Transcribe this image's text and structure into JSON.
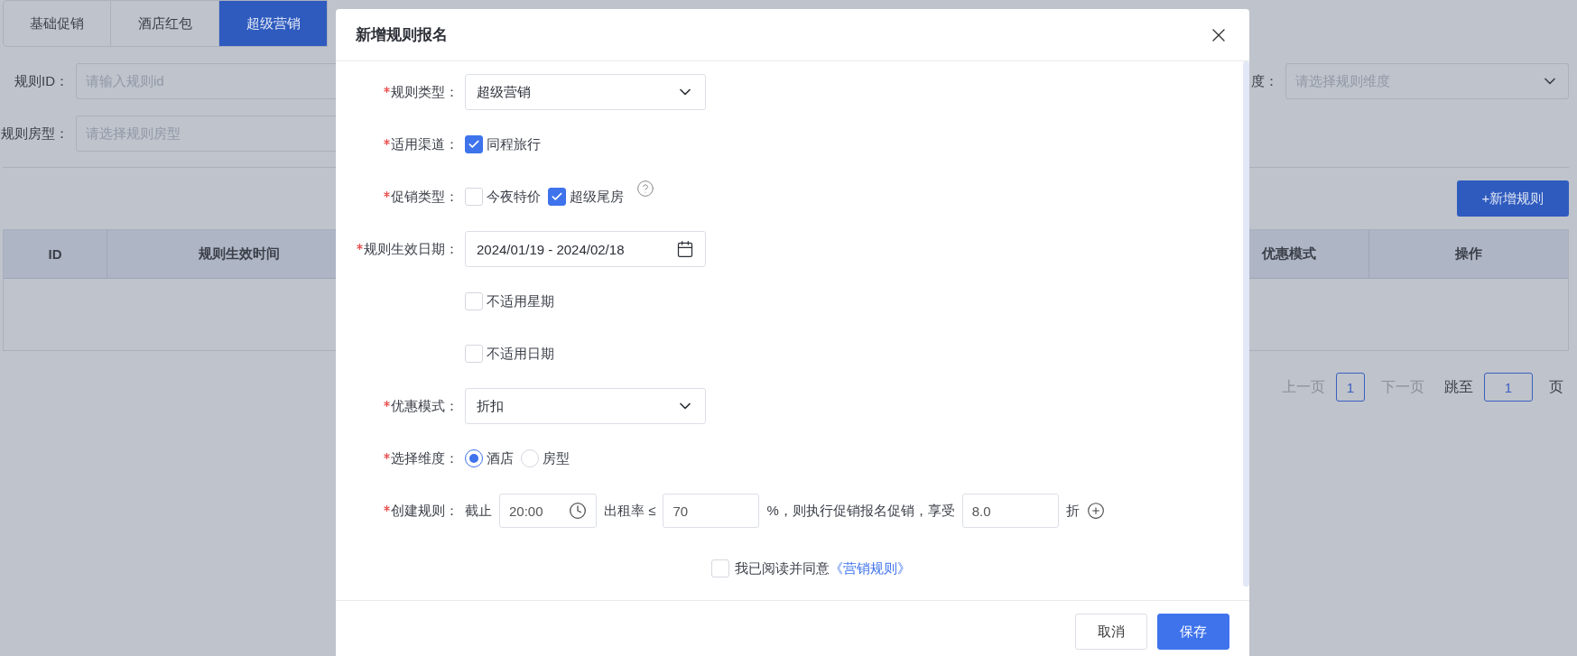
{
  "tabs": [
    {
      "label": "基础促销",
      "selected": false
    },
    {
      "label": "酒店红包",
      "selected": false
    },
    {
      "label": "超级营销",
      "selected": true
    }
  ],
  "filters": [
    {
      "label": "规则ID：",
      "placeholder": "请输入规则id"
    },
    {
      "label": "规则房型：",
      "placeholder": "请选择规则房型"
    }
  ],
  "right_filter": {
    "label": "度：",
    "placeholder": "请选择规则维度"
  },
  "add_button": "+新增规则",
  "table": {
    "columns_left": [
      "ID",
      "规则生效时间"
    ],
    "columns_right": [
      "优惠模式",
      "操作"
    ]
  },
  "pagination": {
    "prev": "上一页",
    "page": "1",
    "next": "下一页",
    "jump_label": "跳至",
    "jump_value": "1",
    "suffix": "页"
  },
  "dialog": {
    "title": "新增规则报名",
    "fields": [
      {
        "kind": "select",
        "label": "规则类型：",
        "required": true,
        "value": "超级营销"
      },
      {
        "kind": "checks",
        "label": "适用渠道：",
        "required": true,
        "options": [
          {
            "label": "同程旅行",
            "checked": true
          }
        ]
      },
      {
        "kind": "checks",
        "label": "促销类型：",
        "required": true,
        "help": true,
        "options": [
          {
            "label": "今夜特价",
            "checked": false
          },
          {
            "label": "超级尾房",
            "checked": true
          }
        ]
      },
      {
        "kind": "date",
        "label": "规则生效日期：",
        "required": true,
        "value": "2024/01/19 - 2024/02/18"
      },
      {
        "kind": "checks",
        "required": false,
        "options": [
          {
            "label": "不适用星期",
            "checked": false
          }
        ]
      },
      {
        "kind": "checks",
        "required": false,
        "options": [
          {
            "label": "不适用日期",
            "checked": false
          }
        ]
      },
      {
        "kind": "select",
        "label": "优惠模式：",
        "required": true,
        "value": "折扣"
      },
      {
        "kind": "radios",
        "label": "选择维度：",
        "required": true,
        "options": [
          {
            "label": "酒店",
            "selected": true
          },
          {
            "label": "房型",
            "selected": false
          }
        ]
      },
      {
        "kind": "rule",
        "label": "创建规则：",
        "required": true,
        "parts": [
          {
            "kind": "text",
            "text": "截止"
          },
          {
            "kind": "time",
            "value": "20:00"
          },
          {
            "kind": "text",
            "text": "出租率 ≤"
          },
          {
            "kind": "input",
            "value": "70"
          },
          {
            "kind": "text",
            "text": "%，则执行促销报名促销，享受"
          },
          {
            "kind": "input",
            "value": "8.0"
          },
          {
            "kind": "text",
            "text": "折"
          },
          {
            "kind": "add"
          }
        ]
      }
    ],
    "agreement": {
      "checked": false,
      "text": "我已阅读并同意",
      "link": "《营销规则》"
    },
    "buttons": [
      {
        "label": "取消",
        "kind": "secondary"
      },
      {
        "label": "保存",
        "kind": "primary"
      }
    ]
  }
}
